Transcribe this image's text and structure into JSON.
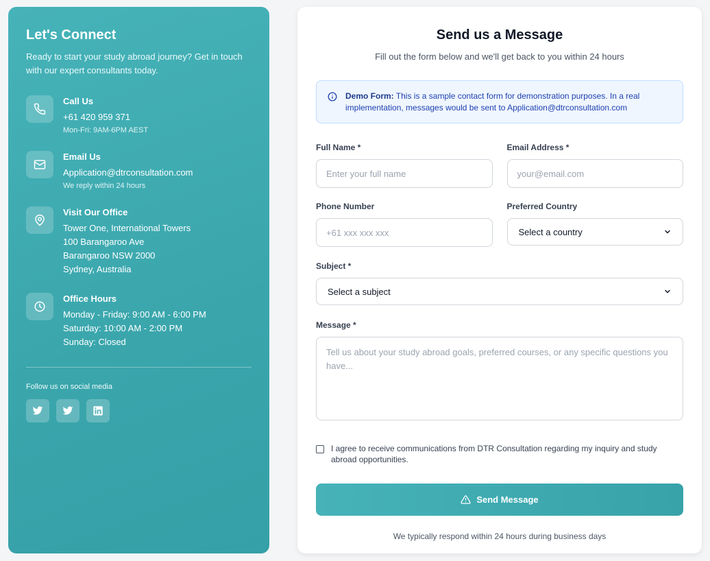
{
  "contact": {
    "title": "Let's Connect",
    "intro": "Ready to start your study abroad journey? Get in touch with our expert consultants today.",
    "call": {
      "title": "Call Us",
      "phone": "+61 420 959 371",
      "hours": "Mon-Fri: 9AM-6PM AEST",
      "icon": "phone-icon"
    },
    "email": {
      "title": "Email Us",
      "address": "Application@dtrconsultation.com",
      "note": "We reply within 24 hours",
      "icon": "mail-icon"
    },
    "office": {
      "title": "Visit Our Office",
      "lines": [
        "Tower One, International Towers",
        "100 Barangaroo Ave",
        "Barangaroo NSW 2000",
        "Sydney, Australia"
      ],
      "icon": "map-pin-icon"
    },
    "hours": {
      "title": "Office Hours",
      "lines": [
        "Monday - Friday: 9:00 AM - 6:00 PM",
        "Saturday: 10:00 AM - 2:00 PM",
        "Sunday: Closed"
      ],
      "icon": "clock-icon"
    },
    "social_label": "Follow us on social media",
    "socials": [
      "twitter-icon",
      "twitter-icon",
      "linkedin-icon"
    ]
  },
  "form": {
    "title": "Send us a Message",
    "lead": "Fill out the form below and we'll get back to you within 24 hours",
    "notice_bold": "Demo Form:",
    "notice_text": " This is a sample contact form for demonstration purposes. In a real implementation, messages would be sent to Application@dtrconsultation.com",
    "full_name": {
      "label": "Full Name *",
      "placeholder": "Enter your full name",
      "value": ""
    },
    "email": {
      "label": "Email Address *",
      "placeholder": "your@email.com",
      "value": ""
    },
    "phone": {
      "label": "Phone Number",
      "placeholder": "+61 xxx xxx xxx",
      "value": ""
    },
    "country": {
      "label": "Preferred Country",
      "selected": "Select a country"
    },
    "subject": {
      "label": "Subject *",
      "selected": "Select a subject"
    },
    "message": {
      "label": "Message *",
      "placeholder": "Tell us about your study abroad goals, preferred courses, or any specific questions you have...",
      "value": ""
    },
    "agree_text": "I agree to receive communications from DTR Consultation regarding my inquiry and study abroad opportunities.",
    "agree_checked": false,
    "submit_label": "Send Message",
    "footer": "We typically respond within 24 hours during business days"
  },
  "colors": {
    "accent": "#3fadb3",
    "notice_bg": "#eff6ff",
    "notice_text": "#1e40af"
  }
}
